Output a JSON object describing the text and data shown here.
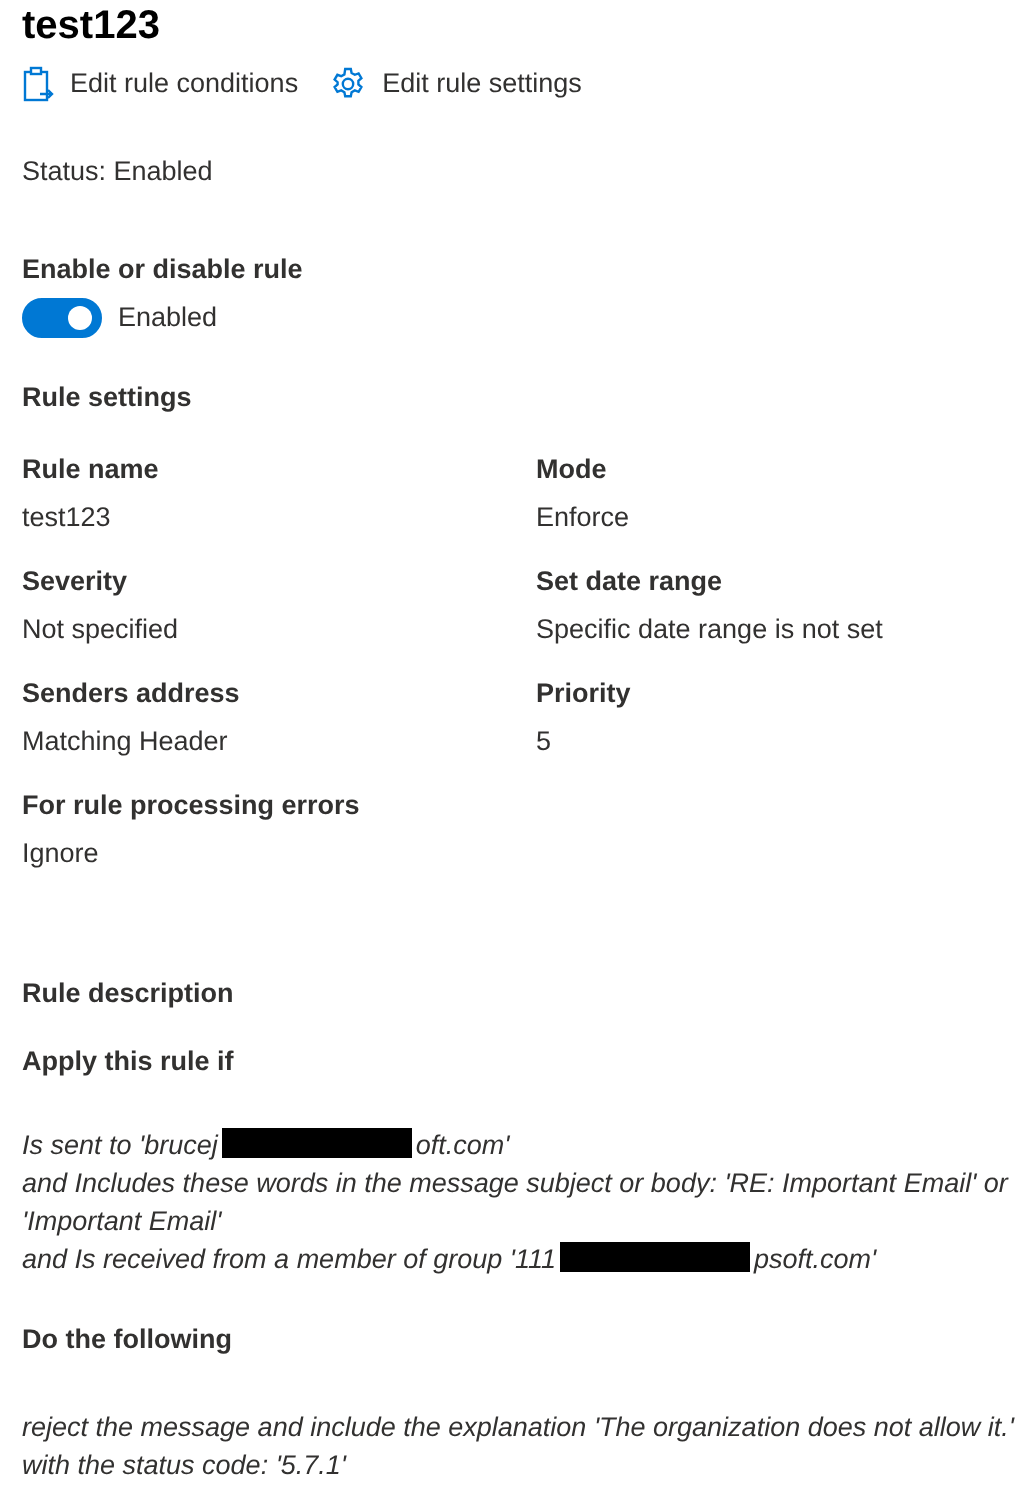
{
  "title": "test123",
  "actions": [
    {
      "kind": "clipboard",
      "label": "Edit rule conditions"
    },
    {
      "kind": "gear",
      "label": "Edit rule settings"
    }
  ],
  "status": "Status: Enabled",
  "toggle": {
    "label": "Enable or disable rule",
    "on": true,
    "text": "Enabled"
  },
  "settings_heading": "Rule settings",
  "settings": [
    {
      "label": "Rule name",
      "value": "test123"
    },
    {
      "label": "Mode",
      "value": "Enforce"
    },
    {
      "label": "Severity",
      "value": "Not specified"
    },
    {
      "label": "Set date range",
      "value": "Specific date range is not set"
    },
    {
      "label": "Senders address",
      "value": "Matching Header"
    },
    {
      "label": "Priority",
      "value": "5"
    },
    {
      "label": "For rule processing errors",
      "value": "Ignore"
    }
  ],
  "description_heading": "Rule description",
  "apply_heading": "Apply this rule if",
  "conditions": [
    {
      "before": "Is sent to 'brucej",
      "redacted": true,
      "after": "oft.com'"
    },
    {
      "before": "and Includes these words in the message subject or body: 'RE: Important Email' or 'Important Email'",
      "redacted": false
    },
    {
      "before": "and Is received from a member of group '111",
      "redacted": true,
      "after": "psoft.com'"
    }
  ],
  "do_heading": "Do the following",
  "action_text": "reject the message and include the explanation 'The organization does not allow it.' with the status code: '5.7.1'"
}
